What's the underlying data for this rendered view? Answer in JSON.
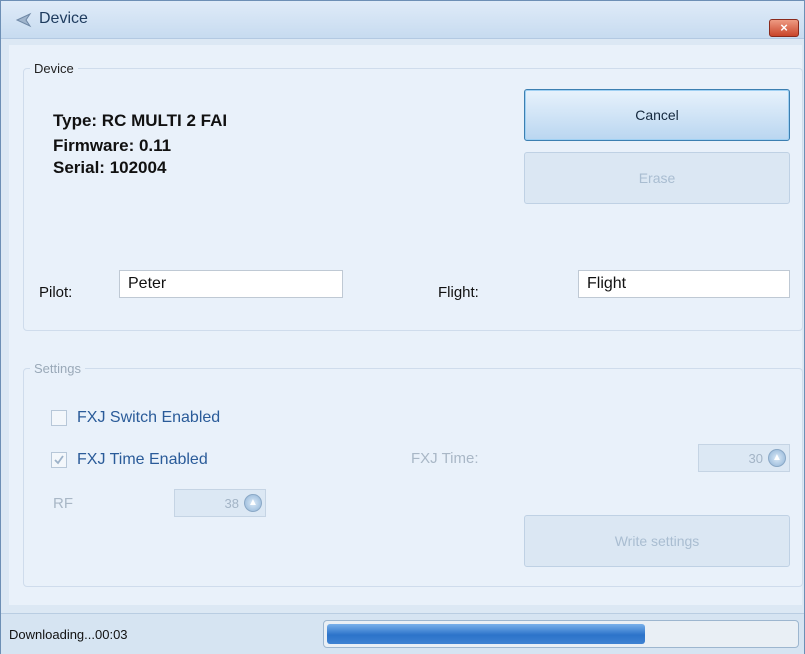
{
  "window": {
    "title": "Device",
    "close_glyph": "×"
  },
  "device": {
    "legend": "Device",
    "type": "Type: RC MULTI 2 FAI",
    "firmware": "Firmware: 0.11",
    "serial": "Serial: 102004",
    "cancel_label": "Cancel",
    "erase_label": "Erase",
    "pilot_label": "Pilot:",
    "pilot_value": "Peter",
    "flight_label": "Flight:",
    "flight_value": "Flight"
  },
  "settings": {
    "legend": "Settings",
    "fxj_switch_label": "FXJ Switch Enabled",
    "fxj_switch_checked": false,
    "fxj_time_enabled_label": "FXJ Time Enabled",
    "fxj_time_enabled_checked": true,
    "fxj_time_label": "FXJ Time:",
    "fxj_time_value": "30",
    "rf_label": "RF",
    "rf_value": "38",
    "write_label": "Write settings"
  },
  "status": {
    "text": "Downloading...00:03",
    "progress_fraction": 0.68
  },
  "colors": {
    "accent": "#2c73c9",
    "window_bg": "#dce8f4",
    "close_red": "#c9452a",
    "label_blue": "#2a5b99"
  },
  "icons": {
    "title": "device-back-arrow-icon",
    "close": "close-icon",
    "checkmark": "checkmark-icon",
    "spinner": "spin-button-icon"
  }
}
